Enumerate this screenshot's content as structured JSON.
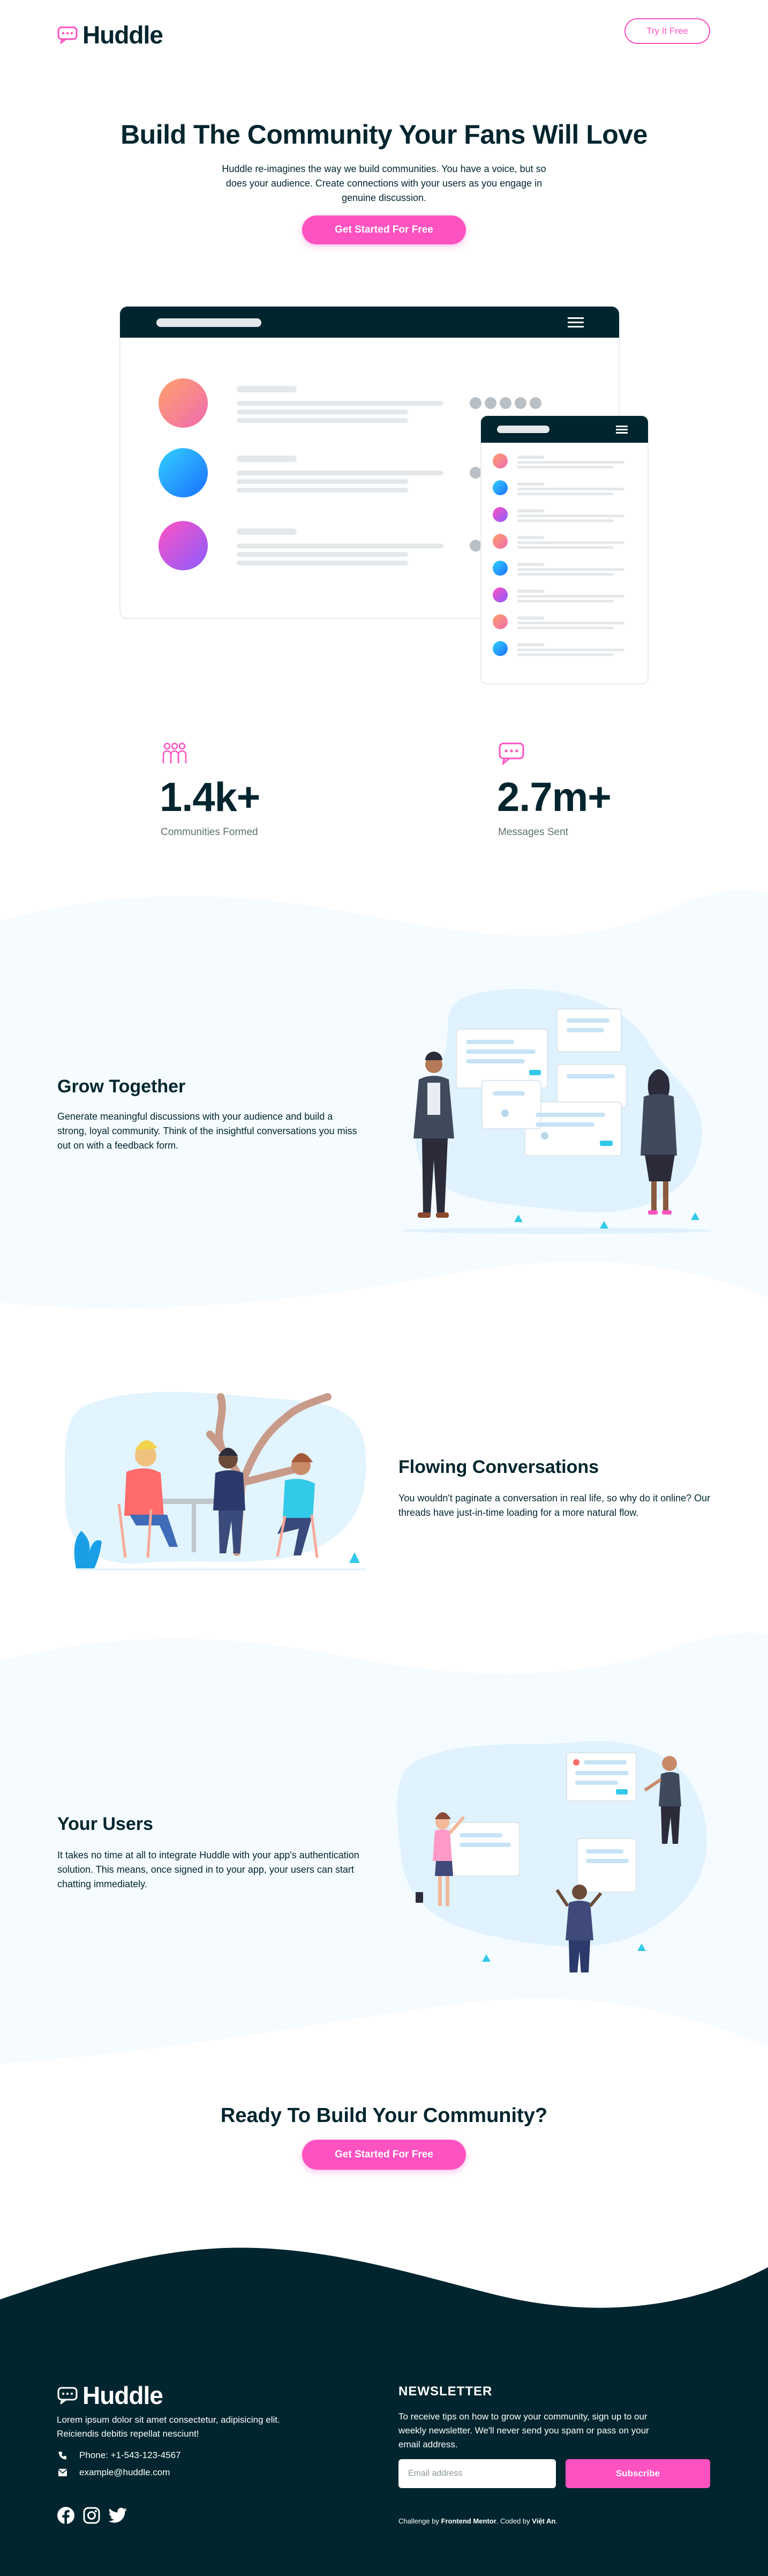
{
  "header": {
    "logo": "Huddle",
    "cta_label": "Try It Free"
  },
  "hero": {
    "title": "Build The Community Your Fans Will Love",
    "text": "Huddle re-imagines the way we build communities. You have a voice, but so does your audience. Create connections with your users as you engage in genuine discussion.",
    "cta_label": "Get Started For Free"
  },
  "stats": [
    {
      "value": "1.4k+",
      "label": "Communities Formed",
      "icon": "communities-icon"
    },
    {
      "value": "2.7m+",
      "label": "Messages Sent",
      "icon": "messages-icon"
    }
  ],
  "features": [
    {
      "title": "Grow Together",
      "text": "Generate meaningful discussions with your audience and build a strong, loyal community. Think of the insightful conversations you miss out on with a feedback form."
    },
    {
      "title": "Flowing Conversations",
      "text": "You wouldn't paginate a conversation in real life, so why do it online? Our threads have just-in-time loading for a more natural flow."
    },
    {
      "title": "Your Users",
      "text": "It takes no time at all to integrate Huddle with your app's authentication solution. This means, once signed in to your app, your users can start chatting immediately."
    }
  ],
  "cta": {
    "title": "Ready To Build Your Community?",
    "button_label": "Get Started For Free"
  },
  "footer": {
    "logo": "Huddle",
    "description": "Lorem ipsum dolor sit amet consectetur, adipisicing elit. Reiciendis debitis repellat nesciunt!",
    "phone": "Phone: +1-543-123-4567",
    "email": "example@huddle.com",
    "newsletter_title": "NEWSLETTER",
    "newsletter_text": "To receive tips on how to grow your community, sign up to our weekly newsletter. We'll never send you spam or pass on your email address.",
    "email_placeholder": "Email address",
    "subscribe_label": "Subscribe",
    "credit_prefix": "Challenge by",
    "credit_org": "Frontend Mentor",
    "credit_mid": ". Coded by",
    "credit_author": "Việt An",
    "credit_suffix": "."
  },
  "colors": {
    "pink": "#ff52c1",
    "dark": "#00252e",
    "light_blue": "#f5fbff"
  }
}
